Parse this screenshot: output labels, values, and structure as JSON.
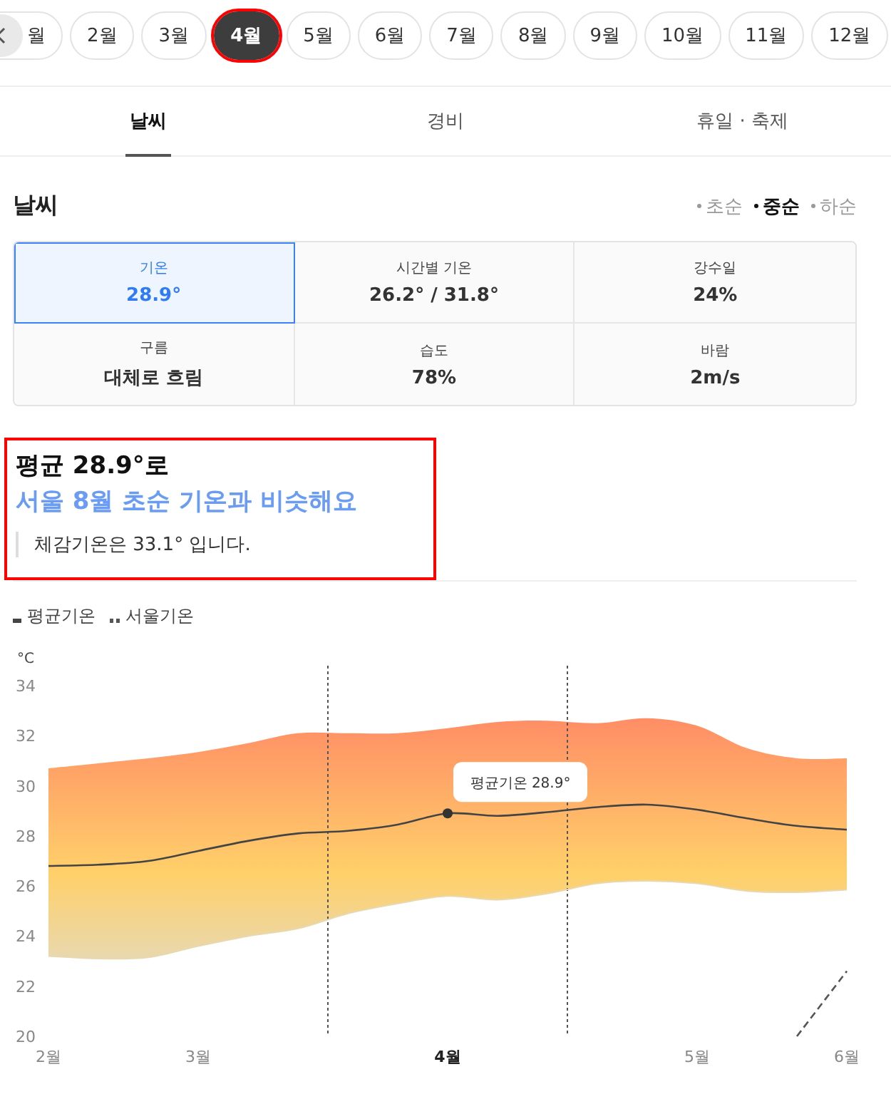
{
  "months": [
    {
      "label": "월",
      "selected": false,
      "highlighted": false
    },
    {
      "label": "2월",
      "selected": false,
      "highlighted": false
    },
    {
      "label": "3월",
      "selected": false,
      "highlighted": false
    },
    {
      "label": "4월",
      "selected": true,
      "highlighted": true
    },
    {
      "label": "5월",
      "selected": false,
      "highlighted": false
    },
    {
      "label": "6월",
      "selected": false,
      "highlighted": false
    },
    {
      "label": "7월",
      "selected": false,
      "highlighted": false
    },
    {
      "label": "8월",
      "selected": false,
      "highlighted": false
    },
    {
      "label": "9월",
      "selected": false,
      "highlighted": false
    },
    {
      "label": "10월",
      "selected": false,
      "highlighted": false
    },
    {
      "label": "11월",
      "selected": false,
      "highlighted": false
    },
    {
      "label": "12월",
      "selected": false,
      "highlighted": false
    }
  ],
  "tabs": [
    {
      "label": "날씨",
      "selected": true
    },
    {
      "label": "경비",
      "selected": false
    },
    {
      "label": "휴일 · 축제",
      "selected": false
    }
  ],
  "section": {
    "title": "날씨",
    "periods": [
      {
        "label": "초순",
        "selected": false
      },
      {
        "label": "중순",
        "selected": true
      },
      {
        "label": "하순",
        "selected": false
      }
    ]
  },
  "stats": [
    {
      "label": "기온",
      "value": "28.9°",
      "selected": true
    },
    {
      "label": "시간별 기온",
      "value": "26.2° / 31.8°",
      "selected": false
    },
    {
      "label": "강수일",
      "value": "24%",
      "selected": false
    },
    {
      "label": "구름",
      "value": "대체로 흐림",
      "selected": false
    },
    {
      "label": "습도",
      "value": "78%",
      "selected": false
    },
    {
      "label": "바람",
      "value": "2m/s",
      "selected": false
    }
  ],
  "summary": {
    "highlighted": true,
    "headline": "평균 28.9°로",
    "comparison": "서울 8월 초순 기온과 비슷해요",
    "note": "체감기온은 33.1° 입니다."
  },
  "chart": {
    "chart_data": {
      "type": "line",
      "ylabel": "°C",
      "categories": [
        "2월",
        null,
        null,
        "3월",
        null,
        null,
        null,
        null,
        "4월",
        null,
        null,
        null,
        null,
        "5월",
        null,
        null,
        "6월"
      ],
      "ylim": [
        20,
        34
      ],
      "yticks": [
        20,
        22,
        24,
        26,
        28,
        30,
        32,
        34
      ],
      "series": [
        {
          "name": "평균기온",
          "color": "#444444",
          "values": [
            26.8,
            26.85,
            27.0,
            27.4,
            27.8,
            28.1,
            28.2,
            28.45,
            28.9,
            28.8,
            28.95,
            29.15,
            29.25,
            29.05,
            28.7,
            28.4,
            28.25
          ]
        },
        {
          "name": "서울기온",
          "color": "#555555",
          "line_style": "dashed",
          "values": [
            null,
            null,
            null,
            null,
            null,
            null,
            null,
            null,
            null,
            null,
            null,
            null,
            null,
            null,
            null,
            20.0,
            22.6
          ]
        },
        {
          "type": "area",
          "color": "#ff8a65",
          "values": [
            30.7,
            30.9,
            31.1,
            31.35,
            31.7,
            32.1,
            32.1,
            32.1,
            32.3,
            32.55,
            32.6,
            32.5,
            32.7,
            32.4,
            31.5,
            31.1,
            31.1
          ]
        },
        {
          "color": "#e8d8b0",
          "values": [
            23.2,
            23.1,
            23.15,
            23.6,
            24.0,
            24.3,
            24.9,
            25.3,
            25.6,
            25.45,
            25.7,
            26.1,
            26.2,
            26.1,
            25.8,
            25.75,
            25.85
          ]
        }
      ],
      "annotations": [
        {
          "x": "4월",
          "y": 28.9,
          "text": "평균기온 28.9°"
        }
      ]
    }
  }
}
